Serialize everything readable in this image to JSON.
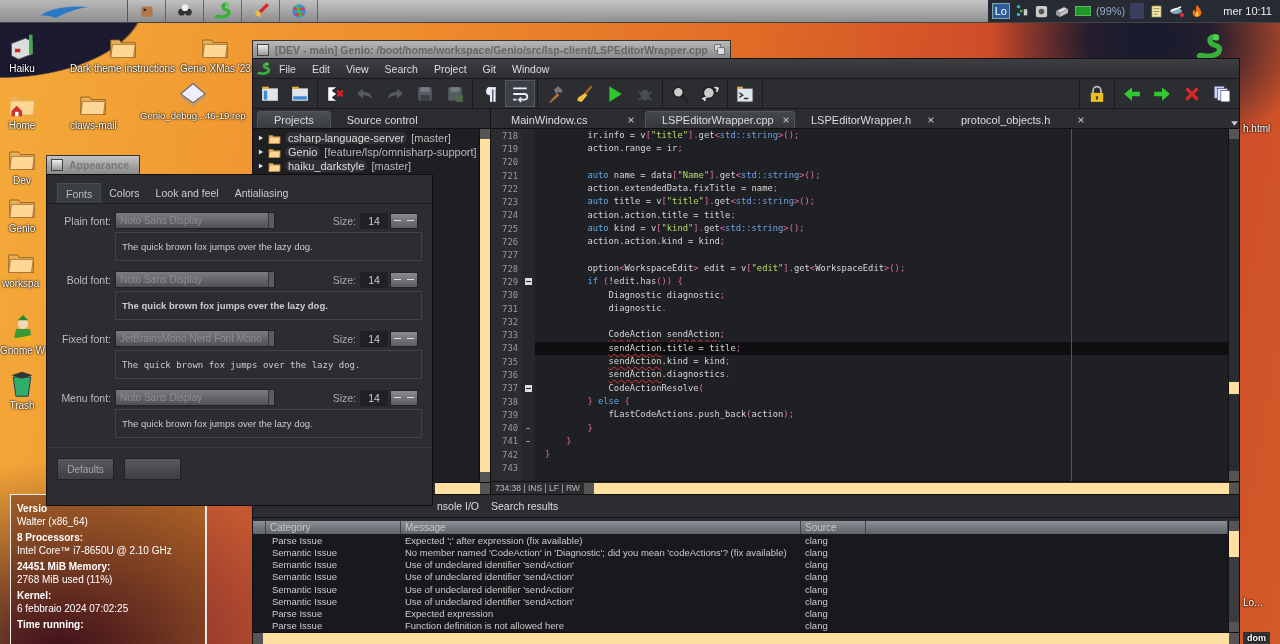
{
  "deskbar": {
    "keymap": "Lo",
    "battery_reading": "(99%)",
    "clock": "mer 10:11"
  },
  "desktop_icons": [
    {
      "label": "Haiku",
      "kind": "drive"
    },
    {
      "label": "Home",
      "kind": "home"
    },
    {
      "label": "Dev",
      "kind": "folder"
    },
    {
      "label": "Genio",
      "kind": "folder"
    },
    {
      "label": "workspa",
      "kind": "folder"
    },
    {
      "label": "Gnome W",
      "kind": "gnome"
    },
    {
      "label": "Trash",
      "kind": "trash"
    },
    {
      "label": "Dark theme instructions",
      "kind": "folder"
    },
    {
      "label": "claws-mail",
      "kind": "folder"
    },
    {
      "label": "Genio XMas '23",
      "kind": "folder"
    },
    {
      "label": "Genio_debug...46-19.rep",
      "kind": "file"
    },
    {
      "kind": "snake"
    },
    {
      "label": "h.html"
    },
    {
      "label": "Lo..."
    },
    {
      "label": "dom",
      "kind": "tag"
    }
  ],
  "genio": {
    "title": "[DEV - main] Genio: /boot/home/workspace/Genio/src/lsp-client/LSPEditorWrapper.cpp",
    "menu": [
      "File",
      "Edit",
      "View",
      "Search",
      "Project",
      "Git",
      "Window"
    ],
    "project_tabs": [
      {
        "label": "Projects",
        "selected": true
      },
      {
        "label": "Source control",
        "selected": false
      }
    ],
    "projects": [
      {
        "name": "csharp-language-server",
        "branch": "[master]"
      },
      {
        "name": "Genio",
        "branch": "[feature/lsp/omnisharp-support]"
      },
      {
        "name": "haiku_darkstyle",
        "branch": "[master]"
      }
    ],
    "editor_tabs": [
      {
        "label": "MainWindow.cs",
        "selected": false
      },
      {
        "label": "LSPEditorWrapper.cpp",
        "selected": true
      },
      {
        "label": "LSPEditorWrapper.h",
        "selected": false
      },
      {
        "label": "protocol_objects.h",
        "selected": false
      }
    ],
    "code": [
      {
        "n": "718",
        "fold_start": false,
        "fold_end": false,
        "current": false,
        "tokens": [
          {
            "text": "        ir.info = v",
            "kind": "plain"
          },
          {
            "text": "[",
            "kind": "punct"
          },
          {
            "text": "\"title\"",
            "kind": "string"
          },
          {
            "text": "].",
            "kind": "punct"
          },
          {
            "text": "get",
            "kind": "plain"
          },
          {
            "text": "<",
            "kind": "punct"
          },
          {
            "text": "std::string",
            "kind": "type"
          },
          {
            "text": ">();",
            "kind": "punct"
          }
        ]
      },
      {
        "n": "719",
        "fold_start": false,
        "fold_end": false,
        "current": false,
        "tokens": [
          {
            "text": "        action.range = ir",
            "kind": "plain"
          },
          {
            "text": ";",
            "kind": "punct"
          }
        ]
      },
      {
        "n": "720",
        "fold_start": false,
        "fold_end": false,
        "current": false
      },
      {
        "n": "721",
        "fold_start": false,
        "fold_end": false,
        "current": false,
        "tokens": [
          {
            "text": "        auto",
            "kind": "keyword"
          },
          {
            "text": " name = data",
            "kind": "plain"
          },
          {
            "text": "[",
            "kind": "punct"
          },
          {
            "text": "\"Name\"",
            "kind": "string"
          },
          {
            "text": "].",
            "kind": "punct"
          },
          {
            "text": "get",
            "kind": "plain"
          },
          {
            "text": "<",
            "kind": "punct"
          },
          {
            "text": "std::string",
            "kind": "type"
          },
          {
            "text": ">();",
            "kind": "punct"
          }
        ]
      },
      {
        "n": "722",
        "fold_start": false,
        "fold_end": false,
        "current": false,
        "tokens": [
          {
            "text": "        action.extendedData.fixTitle = name",
            "kind": "plain"
          },
          {
            "text": ";",
            "kind": "punct"
          }
        ]
      },
      {
        "n": "723",
        "fold_start": false,
        "fold_end": false,
        "current": false,
        "tokens": [
          {
            "text": "        auto",
            "kind": "keyword"
          },
          {
            "text": " title = v",
            "kind": "plain"
          },
          {
            "text": "[",
            "kind": "punct"
          },
          {
            "text": "\"title\"",
            "kind": "string"
          },
          {
            "text": "].",
            "kind": "punct"
          },
          {
            "text": "get",
            "kind": "plain"
          },
          {
            "text": "<",
            "kind": "punct"
          },
          {
            "text": "std::string",
            "kind": "type"
          },
          {
            "text": ">();",
            "kind": "punct"
          }
        ]
      },
      {
        "n": "724",
        "fold_start": false,
        "fold_end": false,
        "current": false,
        "tokens": [
          {
            "text": "        action.action.title = title",
            "kind": "plain"
          },
          {
            "text": ";",
            "kind": "punct"
          }
        ]
      },
      {
        "n": "725",
        "fold_start": false,
        "fold_end": false,
        "current": false,
        "tokens": [
          {
            "text": "        auto",
            "kind": "keyword"
          },
          {
            "text": " kind = v",
            "kind": "plain"
          },
          {
            "text": "[",
            "kind": "punct"
          },
          {
            "text": "\"kind\"",
            "kind": "string"
          },
          {
            "text": "].",
            "kind": "punct"
          },
          {
            "text": "get",
            "kind": "plain"
          },
          {
            "text": "<",
            "kind": "punct"
          },
          {
            "text": "std::string",
            "kind": "type"
          },
          {
            "text": ">();",
            "kind": "punct"
          }
        ]
      },
      {
        "n": "726",
        "fold_start": false,
        "fold_end": false,
        "current": false,
        "tokens": [
          {
            "text": "        action.action.kind = kind",
            "kind": "plain"
          },
          {
            "text": ";",
            "kind": "punct"
          }
        ]
      },
      {
        "n": "727",
        "fold_start": false,
        "fold_end": false,
        "current": false
      },
      {
        "n": "728",
        "fold_start": false,
        "fold_end": false,
        "current": false,
        "tokens": [
          {
            "text": "        option",
            "kind": "plain"
          },
          {
            "text": "<",
            "kind": "punct"
          },
          {
            "text": "WorkspaceEdit",
            "kind": "plain"
          },
          {
            "text": ">",
            "kind": "punct"
          },
          {
            "text": " edit = v",
            "kind": "plain"
          },
          {
            "text": "[",
            "kind": "punct"
          },
          {
            "text": "\"edit\"",
            "kind": "string"
          },
          {
            "text": "].",
            "kind": "punct"
          },
          {
            "text": "get",
            "kind": "plain"
          },
          {
            "text": "<",
            "kind": "punct"
          },
          {
            "text": "WorkspaceEdit",
            "kind": "plain"
          },
          {
            "text": ">();",
            "kind": "punct"
          }
        ]
      },
      {
        "n": "729",
        "fold_start": true,
        "fold_end": false,
        "current": false,
        "tokens": [
          {
            "text": "        if",
            "kind": "keyword"
          },
          {
            "text": " (",
            "kind": "punct"
          },
          {
            "text": "!edit.has",
            "kind": "plain"
          },
          {
            "text": "()) {",
            "kind": "punct"
          }
        ]
      },
      {
        "n": "730",
        "fold_start": false,
        "fold_end": false,
        "current": false,
        "tokens": [
          {
            "text": "            Diagnostic diagnostic",
            "kind": "plain"
          },
          {
            "text": ";",
            "kind": "punct"
          }
        ]
      },
      {
        "n": "731",
        "fold_start": false,
        "fold_end": false,
        "current": false,
        "tokens": [
          {
            "text": "            diagnostic",
            "kind": "plain"
          },
          {
            "text": ".",
            "kind": "punct"
          }
        ]
      },
      {
        "n": "732",
        "fold_start": false,
        "fold_end": false,
        "current": false
      },
      {
        "n": "733",
        "fold_start": false,
        "fold_end": false,
        "current": false,
        "tokens": [
          {
            "text": "            CodeAction",
            "kind": "error"
          },
          {
            "text": " sendAction",
            "kind": "error"
          },
          {
            "text": ";",
            "kind": "punct"
          }
        ]
      },
      {
        "n": "734",
        "fold_start": false,
        "fold_end": false,
        "current": true,
        "tokens": [
          {
            "text": "            sendAction",
            "kind": "error"
          },
          {
            "text": ".title = title",
            "kind": "plain"
          },
          {
            "text": ";",
            "kind": "punct"
          }
        ]
      },
      {
        "n": "735",
        "fold_start": false,
        "fold_end": false,
        "current": false,
        "tokens": [
          {
            "text": "            sendAction",
            "kind": "error"
          },
          {
            "text": ".kind = kind",
            "kind": "plain"
          },
          {
            "text": ";",
            "kind": "punct"
          }
        ]
      },
      {
        "n": "736",
        "fold_start": false,
        "fold_end": false,
        "current": false,
        "tokens": [
          {
            "text": "            sendAction",
            "kind": "error"
          },
          {
            "text": ".diagnostics",
            "kind": "plain"
          },
          {
            "text": ".",
            "kind": "punct"
          }
        ]
      },
      {
        "n": "737",
        "fold_start": true,
        "fold_end": false,
        "current": false,
        "tokens": [
          {
            "text": "            CodeActionResolve",
            "kind": "plain"
          },
          {
            "text": "(",
            "kind": "punct"
          }
        ]
      },
      {
        "n": "738",
        "fold_start": false,
        "fold_end": false,
        "current": false,
        "tokens": [
          {
            "text": "        }",
            "kind": "punct"
          },
          {
            "text": " else",
            "kind": "keyword"
          },
          {
            "text": " {",
            "kind": "punct"
          }
        ]
      },
      {
        "n": "739",
        "fold_start": false,
        "fold_end": false,
        "current": false,
        "tokens": [
          {
            "text": "            fLastCodeActions.push_back",
            "kind": "plain"
          },
          {
            "text": "(",
            "kind": "punct"
          },
          {
            "text": "action",
            "kind": "plain"
          },
          {
            "text": ");",
            "kind": "punct"
          }
        ]
      },
      {
        "n": "740",
        "fold_start": false,
        "fold_end": true,
        "current": false,
        "tokens": [
          {
            "text": "        }",
            "kind": "punct"
          }
        ]
      },
      {
        "n": "741",
        "fold_start": false,
        "fold_end": true,
        "current": false,
        "tokens": [
          {
            "text": "    }",
            "kind": "punct"
          }
        ]
      },
      {
        "n": "742",
        "fold_start": false,
        "fold_end": false,
        "current": false,
        "tokens": [
          {
            "text": "}",
            "kind": "punct"
          }
        ]
      },
      {
        "n": "743",
        "fold_start": false,
        "fold_end": false,
        "current": false
      }
    ],
    "status": "734:38 | INS | LF | RW",
    "bottom_tabs": [
      {
        "label": "nsole I/O",
        "selected": false
      },
      {
        "label": "Search results",
        "selected": false
      }
    ],
    "problems": {
      "columns": [
        "Category",
        "Message",
        "Source"
      ],
      "rows": [
        [
          "Parse Issue",
          "Expected ';' after expression (fix available)",
          "clang"
        ],
        [
          "Semantic Issue",
          "No member named 'CodeAction' in 'Diagnostic'; did you mean 'codeActions'? (fix available)",
          "clang"
        ],
        [
          "Semantic Issue",
          "Use of undeclared identifier 'sendAction'",
          "clang"
        ],
        [
          "Semantic Issue",
          "Use of undeclared identifier 'sendAction'",
          "clang"
        ],
        [
          "Semantic Issue",
          "Use of undeclared identifier 'sendAction'",
          "clang"
        ],
        [
          "Semantic Issue",
          "Use of undeclared identifier 'sendAction'",
          "clang"
        ],
        [
          "Parse Issue",
          "Expected expression",
          "clang"
        ],
        [
          "Parse Issue",
          "Function definition is not allowed here",
          "clang"
        ]
      ]
    }
  },
  "appearance": {
    "title": "Appearance",
    "tabs": [
      {
        "label": "Fonts",
        "selected": true
      },
      {
        "label": "Colors",
        "selected": false
      },
      {
        "label": "Look and feel",
        "selected": false
      },
      {
        "label": "Antialiasing",
        "selected": false
      }
    ],
    "fonts": [
      {
        "kind": "plain",
        "label": "Plain font:",
        "font": "Noto Sans Display",
        "size_label": "Size:",
        "size": "14",
        "sample": "The quick brown fox jumps over the lazy dog."
      },
      {
        "kind": "bold",
        "label": "Bold font:",
        "font": "Noto Sans Display",
        "size_label": "Size:",
        "size": "14",
        "sample": "The quick brown fox jumps over the lazy dog."
      },
      {
        "kind": "fixed",
        "label": "Fixed font:",
        "font": "JetBrainsMono Nerd Font Mono",
        "size_label": "Size:",
        "size": "14",
        "sample": "The quick brown fox jumps over the lazy dog."
      },
      {
        "kind": "menu",
        "label": "Menu font:",
        "font": "Noto Sans Display",
        "size_label": "Size:",
        "size": "14",
        "sample": "The quick brown fox jumps over the lazy dog."
      }
    ],
    "buttons": [
      {
        "label": "Defaults",
        "disabled": true
      },
      {
        "disabled": true
      }
    ]
  },
  "about": {
    "lines": [
      {
        "text": "Versio",
        "kind": "heading"
      },
      {
        "text": "Walter (x86_64)",
        "kind": "value"
      },
      {
        "text": "8 Processors:",
        "kind": "heading"
      },
      {
        "text": "Intel Core™ i7-8650U @ 2.10 GHz",
        "kind": "value"
      },
      {
        "text": "24451 MiB Memory:",
        "kind": "heading"
      },
      {
        "text": "2768 MiB used (11%)",
        "kind": "value"
      },
      {
        "text": "Kernel:",
        "kind": "heading"
      },
      {
        "text": "6 febbraio 2024 07:02:25",
        "kind": "value"
      },
      {
        "text": "Time running:",
        "kind": "heading"
      }
    ]
  }
}
